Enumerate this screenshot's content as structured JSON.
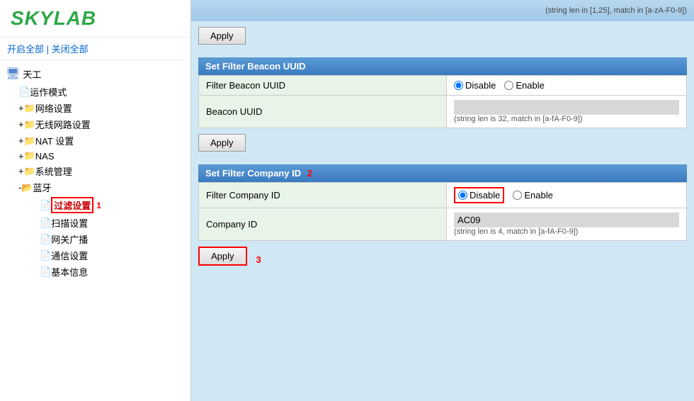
{
  "logo": {
    "text": "SKYLAB"
  },
  "sidebar": {
    "toggle_open": "开启全部",
    "toggle_separator": "|",
    "toggle_close": "关闭全部",
    "root_label": "天工",
    "items": [
      {
        "label": "运作模式",
        "type": "page",
        "indent": 1
      },
      {
        "label": "网络设置",
        "type": "folder",
        "indent": 1,
        "expand": "+"
      },
      {
        "label": "无线网路设置",
        "type": "folder",
        "indent": 1,
        "expand": "+"
      },
      {
        "label": "NAT 设置",
        "type": "folder",
        "indent": 1,
        "expand": "+"
      },
      {
        "label": "NAS",
        "type": "folder",
        "indent": 1,
        "expand": "+"
      },
      {
        "label": "系统管理",
        "type": "folder",
        "indent": 1,
        "expand": "+"
      },
      {
        "label": "蓝牙",
        "type": "folder",
        "indent": 1,
        "expand": "-",
        "active": true
      },
      {
        "label": "过滤设置",
        "type": "page",
        "indent": 2,
        "highlighted": true,
        "number": "1"
      },
      {
        "label": "扫描设置",
        "type": "page",
        "indent": 2
      },
      {
        "label": "网关广播",
        "type": "page",
        "indent": 2
      },
      {
        "label": "通信设置",
        "type": "page",
        "indent": 2
      },
      {
        "label": "基本信息",
        "type": "page",
        "indent": 2
      }
    ]
  },
  "main": {
    "top_bar_text": "(string len in [1,25], match in [a-zA-F0-9])",
    "first_apply_label": "Apply",
    "sections": [
      {
        "id": "filter_beacon_uuid",
        "header": "Set Filter Beacon UUID",
        "rows": [
          {
            "label": "Filter Beacon UUID",
            "type": "radio",
            "options": [
              "Disable",
              "Enable"
            ],
            "selected": "Disable"
          },
          {
            "label": "Beacon UUID",
            "type": "input_hint",
            "value": "",
            "hint": "(string len is 32, match in [a-fA-F0-9])"
          }
        ],
        "apply_label": "Apply"
      },
      {
        "id": "filter_company_id",
        "header": "Set Filter Company ID",
        "number": "2",
        "rows": [
          {
            "label": "Filter Company ID",
            "type": "radio",
            "options": [
              "Disable",
              "Enable"
            ],
            "selected": "Disable",
            "highlighted": true
          },
          {
            "label": "Company ID",
            "type": "input_hint",
            "value": "AC09",
            "hint": "(string len is 4, match in [a-fA-F0-9])"
          }
        ],
        "apply_label": "Apply",
        "apply_number": "3",
        "apply_highlighted": true
      }
    ]
  }
}
